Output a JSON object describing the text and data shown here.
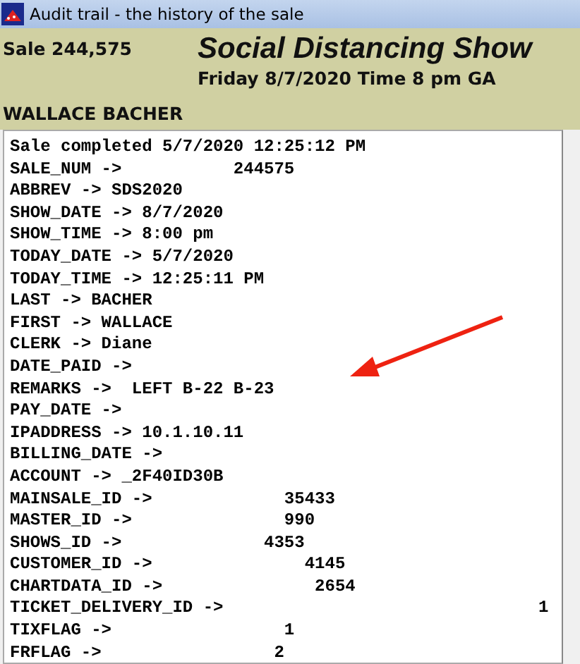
{
  "window": {
    "title": "Audit trail - the history of the sale"
  },
  "header": {
    "sale": "Sale 244,575",
    "show": "Social Distancing Show",
    "when": "Friday 8/7/2020  Time 8 pm GA",
    "customer": "WALLACE BACHER"
  },
  "log": {
    "lines": [
      "Sale completed 5/7/2020 12:25:12 PM",
      "SALE_NUM ->           244575",
      "ABBREV -> SDS2020",
      "SHOW_DATE -> 8/7/2020",
      "SHOW_TIME -> 8:00 pm",
      "TODAY_DATE -> 5/7/2020",
      "TODAY_TIME -> 12:25:11 PM",
      "LAST -> BACHER",
      "FIRST -> WALLACE",
      "CLERK -> Diane",
      "DATE_PAID ->",
      "REMARKS ->  LEFT B-22 B-23",
      "PAY_DATE ->",
      "IPADDRESS -> 10.1.10.11",
      "BILLING_DATE ->",
      "ACCOUNT -> _2F40ID30B",
      "MAINSALE_ID ->             35433",
      "MASTER_ID ->               990",
      "SHOWS_ID ->              4353",
      "CUSTOMER_ID ->               4145",
      "CHARTDATA_ID ->               2654",
      "TICKET_DELIVERY_ID ->                               1",
      "TIXFLAG ->                 1",
      "FRFLAG ->                 2"
    ]
  }
}
